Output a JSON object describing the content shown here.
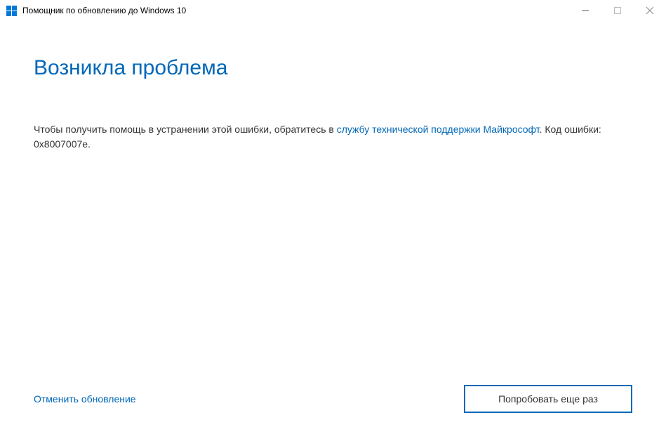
{
  "titlebar": {
    "title": "Помощник по обновлению до Windows 10"
  },
  "content": {
    "heading": "Возникла проблема",
    "body_prefix": "Чтобы получить помощь в устранении этой ошибки, обратитесь в ",
    "support_link": "службу технической поддержки Майкрософт",
    "body_suffix": ". Код ошибки: 0x8007007e."
  },
  "footer": {
    "cancel_label": "Отменить обновление",
    "retry_label": "Попробовать еще раз"
  }
}
